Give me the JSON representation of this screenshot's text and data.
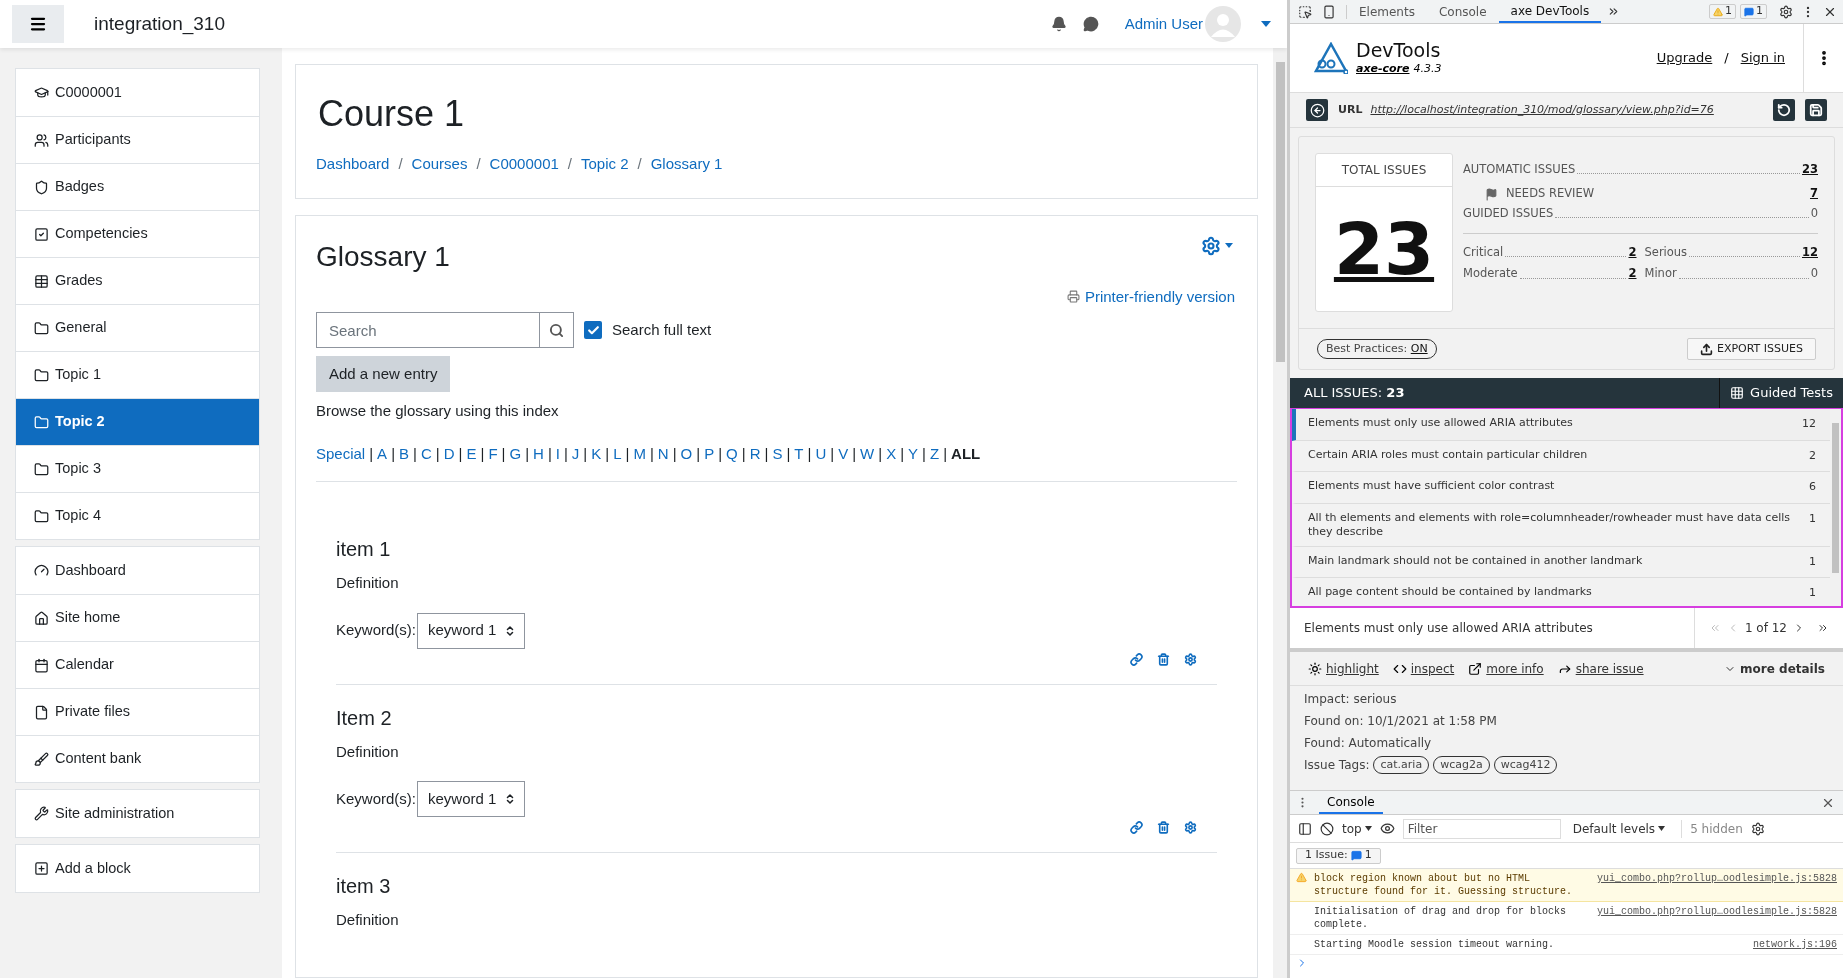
{
  "header": {
    "site_name": "integration_310",
    "user_name": "Admin User"
  },
  "sidebar": {
    "groups": [
      {
        "items": [
          {
            "label": "C0000001",
            "kind": "course",
            "selected": false
          },
          {
            "label": "Participants",
            "kind": "users",
            "selected": false
          },
          {
            "label": "Badges",
            "kind": "badge",
            "selected": false
          },
          {
            "label": "Competencies",
            "kind": "check",
            "selected": false
          },
          {
            "label": "Grades",
            "kind": "table",
            "selected": false
          },
          {
            "label": "General",
            "kind": "folder",
            "selected": false
          },
          {
            "label": "Topic 1",
            "kind": "folder",
            "selected": false
          },
          {
            "label": "Topic 2",
            "kind": "folder",
            "selected": true
          },
          {
            "label": "Topic 3",
            "kind": "folder",
            "selected": false
          },
          {
            "label": "Topic 4",
            "kind": "folder",
            "selected": false
          }
        ]
      },
      {
        "items": [
          {
            "label": "Dashboard",
            "kind": "dashboard",
            "selected": false
          },
          {
            "label": "Site home",
            "kind": "home",
            "selected": false
          },
          {
            "label": "Calendar",
            "kind": "calendar",
            "selected": false
          },
          {
            "label": "Private files",
            "kind": "file",
            "selected": false
          },
          {
            "label": "Content bank",
            "kind": "brush",
            "selected": false
          }
        ]
      },
      {
        "items": [
          {
            "label": "Site administration",
            "kind": "wrench",
            "selected": false
          }
        ]
      },
      {
        "items": [
          {
            "label": "Add a block",
            "kind": "plus",
            "selected": false
          }
        ]
      }
    ]
  },
  "course": {
    "title": "Course 1",
    "breadcrumbs": [
      {
        "label": "Dashboard",
        "separator": "/"
      },
      {
        "label": "Courses",
        "separator": "/"
      },
      {
        "label": "C0000001",
        "separator": "/"
      },
      {
        "label": "Topic 2",
        "separator": "/"
      },
      {
        "label": "Glossary 1"
      }
    ]
  },
  "glossary": {
    "title": "Glossary 1",
    "printer_link": "Printer-friendly version",
    "search": {
      "placeholder": "Search"
    },
    "full_text": {
      "label": "Search full text",
      "checked": true
    },
    "add_button": "Add a new entry",
    "browse_text": "Browse the glossary using this index",
    "index": [
      {
        "label": "Special",
        "selected": false,
        "separator": "|"
      },
      {
        "label": "A",
        "selected": false,
        "separator": "|"
      },
      {
        "label": "B",
        "selected": false,
        "separator": "|"
      },
      {
        "label": "C",
        "selected": false,
        "separator": "|"
      },
      {
        "label": "D",
        "selected": false,
        "separator": "|"
      },
      {
        "label": "E",
        "selected": false,
        "separator": "|"
      },
      {
        "label": "F",
        "selected": false,
        "separator": "|"
      },
      {
        "label": "G",
        "selected": false,
        "separator": "|"
      },
      {
        "label": "H",
        "selected": false,
        "separator": "|"
      },
      {
        "label": "I",
        "selected": false,
        "separator": "|"
      },
      {
        "label": "J",
        "selected": false,
        "separator": "|"
      },
      {
        "label": "K",
        "selected": false,
        "separator": "|"
      },
      {
        "label": "L",
        "selected": false,
        "separator": "|"
      },
      {
        "label": "M",
        "selected": false,
        "separator": "|"
      },
      {
        "label": "N",
        "selected": false,
        "separator": "|"
      },
      {
        "label": "O",
        "selected": false,
        "separator": "|"
      },
      {
        "label": "P",
        "selected": false,
        "separator": "|"
      },
      {
        "label": "Q",
        "selected": false,
        "separator": "|"
      },
      {
        "label": "R",
        "selected": false,
        "separator": "|"
      },
      {
        "label": "S",
        "selected": false,
        "separator": "|"
      },
      {
        "label": "T",
        "selected": false,
        "separator": "|"
      },
      {
        "label": "U",
        "selected": false,
        "separator": "|"
      },
      {
        "label": "V",
        "selected": false,
        "separator": "|"
      },
      {
        "label": "W",
        "selected": false,
        "separator": "|"
      },
      {
        "label": "X",
        "selected": false,
        "separator": "|"
      },
      {
        "label": "Y",
        "selected": false,
        "separator": "|"
      },
      {
        "label": "Z",
        "selected": false,
        "separator": "|"
      },
      {
        "label": "ALL",
        "selected": true
      }
    ],
    "entries": [
      {
        "title": "item 1",
        "definition": "Definition",
        "keyword_label": "Keyword(s):",
        "keyword": "keyword 1"
      },
      {
        "title": "Item 2",
        "definition": "Definition",
        "keyword_label": "Keyword(s):",
        "keyword": "keyword 1"
      },
      {
        "title": "item 3",
        "definition": "Definition"
      }
    ]
  },
  "devtools": {
    "tabs": [
      {
        "label": "Elements",
        "selected": false
      },
      {
        "label": "Console",
        "selected": false
      },
      {
        "label": "axe DevTools",
        "selected": true
      }
    ],
    "warnings": "1",
    "messages": "1",
    "axe": {
      "title": "DevTools",
      "core_link": "axe-core",
      "version": "4.3.3",
      "upgrade": "Upgrade",
      "separator": "/",
      "sign_in": "Sign in",
      "url_label": "URL",
      "url": "http://localhost/integration_310/mod/glossary/view.php?id=76",
      "summary": {
        "total_label": "TOTAL ISSUES",
        "total": "23",
        "rows": [
          {
            "label": "AUTOMATIC ISSUES",
            "value": "23",
            "kind": "main"
          },
          {
            "label": "NEEDS REVIEW",
            "value": "7",
            "kind": "sub"
          },
          {
            "label": "GUIDED ISSUES",
            "value": "0",
            "kind": "main"
          }
        ],
        "impacts": [
          {
            "label": "Critical",
            "value": "2"
          },
          {
            "label": "Serious",
            "value": "12"
          },
          {
            "label": "Moderate",
            "value": "2"
          },
          {
            "label": "Minor",
            "value": "0"
          }
        ],
        "best_practices_label": "Best Practices:",
        "best_practices_value": "ON",
        "export": "EXPORT ISSUES"
      },
      "all_issues_label": "ALL ISSUES:",
      "all_issues_count": "23",
      "guided_tests": "Guided Tests",
      "issues": [
        {
          "text": "Elements must only use allowed ARIA attributes",
          "count": "12",
          "selected": true
        },
        {
          "text": "Certain ARIA roles must contain particular children",
          "count": "2",
          "selected": false
        },
        {
          "text": "Elements must have sufficient color contrast",
          "count": "6",
          "selected": false
        },
        {
          "text": "All th elements and elements with role=columnheader/rowheader must have data cells they describe",
          "count": "1",
          "selected": false
        },
        {
          "text": "Main landmark should not be contained in another landmark",
          "count": "1",
          "selected": false
        },
        {
          "text": "All page content should be contained by landmarks",
          "count": "1",
          "selected": false
        }
      ],
      "current_issue": "Elements must only use allowed ARIA attributes",
      "pager": "1 of 12",
      "actions": [
        "highlight",
        "inspect",
        "more info",
        "share issue"
      ],
      "more_details": "more details",
      "details": [
        {
          "label": "Impact:",
          "value": "serious"
        },
        {
          "label": "Found on:",
          "value": "10/1/2021 at 1:58 PM"
        },
        {
          "label": "Found:",
          "value": "Automatically"
        }
      ],
      "tags_label": "Issue Tags:",
      "tags": [
        "cat.aria",
        "wcag2a",
        "wcag412"
      ]
    },
    "console": {
      "tab": "Console",
      "context": "top",
      "filter_placeholder": "Filter",
      "levels": "Default levels",
      "hidden": "5 hidden",
      "issues_label": "1 Issue:",
      "issues_count": "1",
      "messages": [
        {
          "kind": "warning",
          "text": "block region known about but no HTML structure found for it. Guessing structure.",
          "source": "yui_combo.php?rollup…oodlesimple.js:5828"
        },
        {
          "kind": "info",
          "text": "Initialisation of drag and drop for blocks complete.",
          "source": "yui_combo.php?rollup…oodlesimple.js:5828"
        },
        {
          "kind": "info",
          "text": "Starting Moodle session timeout warning.",
          "source": "network.js:196"
        }
      ]
    }
  }
}
